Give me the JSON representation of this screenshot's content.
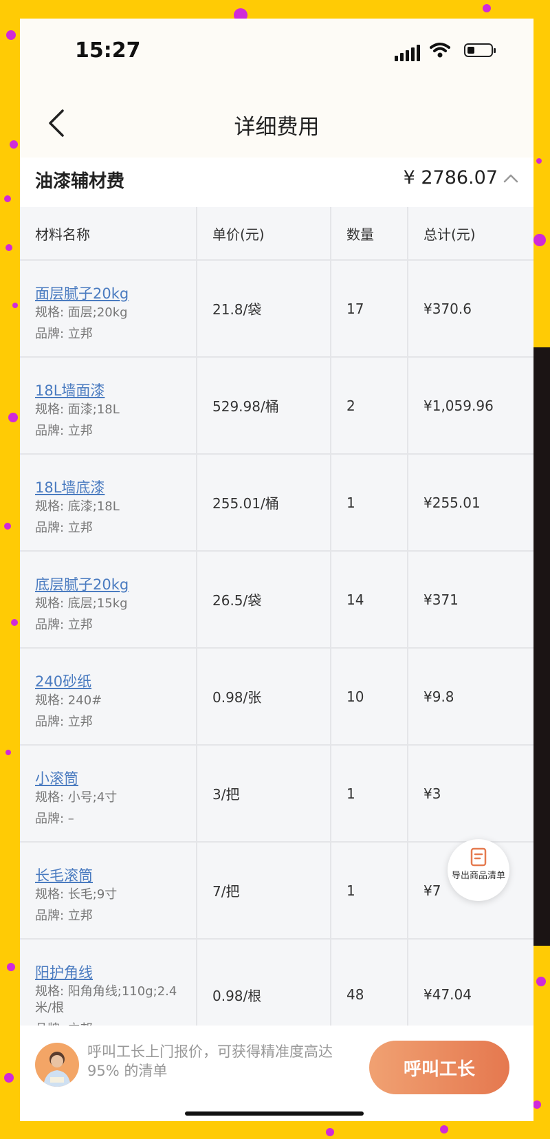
{
  "status_bar": {
    "time": "15:27"
  },
  "nav": {
    "title": "详细费用"
  },
  "section": {
    "title": "油漆辅材费",
    "total": "¥ 2786.07"
  },
  "table": {
    "headers": [
      "材料名称",
      "单价(元)",
      "数量",
      "总计(元)"
    ],
    "rows": [
      {
        "name": "面层腻子20kg",
        "spec": "规格: 面层;20kg",
        "brand": "品牌: 立邦",
        "price": "21.8/袋",
        "qty": "17",
        "total": "¥370.6"
      },
      {
        "name": "18L墙面漆",
        "spec": "规格: 面漆;18L",
        "brand": "品牌: 立邦",
        "price": "529.98/桶",
        "qty": "2",
        "total": "¥1,059.96"
      },
      {
        "name": "18L墙底漆",
        "spec": "规格: 底漆;18L",
        "brand": "品牌: 立邦",
        "price": "255.01/桶",
        "qty": "1",
        "total": "¥255.01"
      },
      {
        "name": "底层腻子20kg",
        "spec": "规格: 底层;15kg",
        "brand": "品牌: 立邦",
        "price": "26.5/袋",
        "qty": "14",
        "total": "¥371"
      },
      {
        "name": "240砂纸",
        "spec": "规格: 240#",
        "brand": "品牌: 立邦",
        "price": "0.98/张",
        "qty": "10",
        "total": "¥9.8"
      },
      {
        "name": "小滚筒",
        "spec": "规格: 小号;4寸",
        "brand": "品牌: –",
        "price": "3/把",
        "qty": "1",
        "total": "¥3"
      },
      {
        "name": "长毛滚筒",
        "spec": "规格: 长毛;9寸",
        "brand": "品牌: 立邦",
        "price": "7/把",
        "qty": "1",
        "total": "¥7"
      },
      {
        "name": "阳护角线",
        "spec": "规格: 阳角角线;110g;2.4米/根",
        "brand": "品牌: 立邦",
        "price": "0.98/根",
        "qty": "48",
        "total": "¥47.04"
      }
    ]
  },
  "export_button": {
    "label": "导出商品清单"
  },
  "footer": {
    "promo": "呼叫工长上门报价，可获得精准度高达 95% 的清单",
    "call_button": "呼叫工长"
  }
}
